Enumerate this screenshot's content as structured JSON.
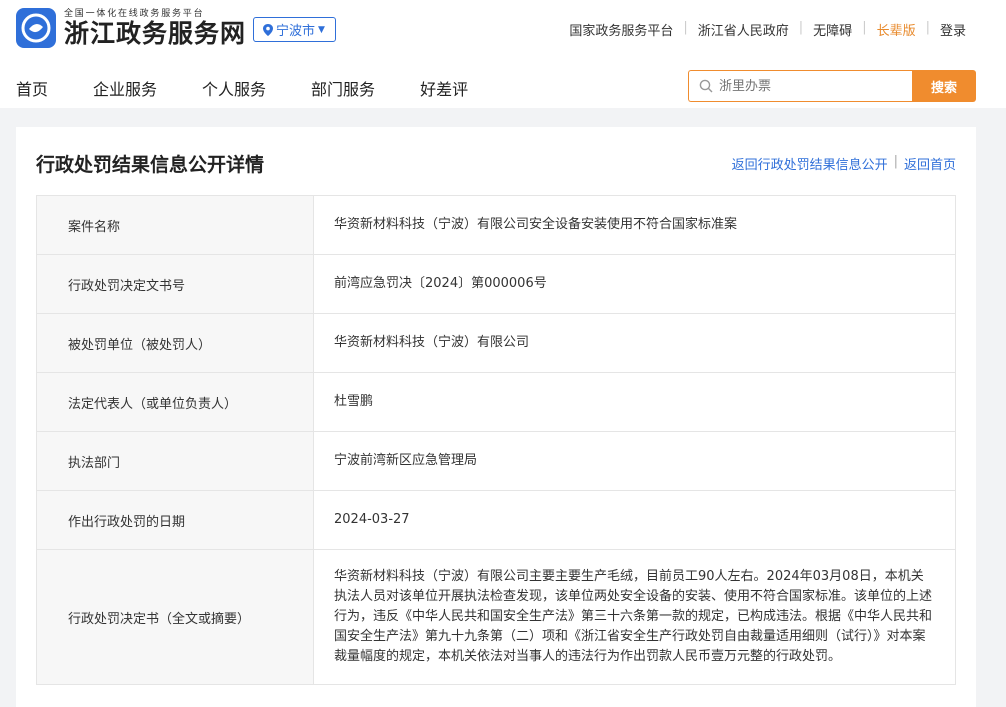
{
  "header": {
    "logo_sub": "全国一体化在线政务服务平台",
    "logo_title": "浙江政务服务网",
    "region": "宁波市",
    "links": [
      "国家政务服务平台",
      "浙江省人民政府",
      "无障碍",
      "长辈版",
      "登录"
    ],
    "accent_color": "#2f6fd9",
    "orange_color": "#f08c2e"
  },
  "nav": [
    "首页",
    "企业服务",
    "个人服务",
    "部门服务",
    "好差评"
  ],
  "search": {
    "placeholder": "浙里办票",
    "button": "搜索"
  },
  "page": {
    "title": "行政处罚结果信息公开详情",
    "back_list": "返回行政处罚结果信息公开",
    "back_home": "返回首页"
  },
  "details": [
    {
      "label": "案件名称",
      "value": "华资新材料科技（宁波）有限公司安全设备安装使用不符合国家标准案"
    },
    {
      "label": "行政处罚决定文书号",
      "value": "前湾应急罚决〔2024〕第000006号"
    },
    {
      "label": "被处罚单位（被处罚人）",
      "value": "华资新材料科技（宁波）有限公司"
    },
    {
      "label": "法定代表人（或单位负责人）",
      "value": "杜雪鹏"
    },
    {
      "label": "执法部门",
      "value": "宁波前湾新区应急管理局"
    },
    {
      "label": "作出行政处罚的日期",
      "value": "2024-03-27"
    },
    {
      "label": "行政处罚决定书（全文或摘要）",
      "value": "华资新材料科技（宁波）有限公司主要主要生产毛绒，目前员工90人左右。2024年03月08日，本机关执法人员对该单位开展执法检查发现，该单位两处安全设备的安装、使用不符合国家标准。该单位的上述行为，违反《中华人民共和国安全生产法》第三十六条第一款的规定，已构成违法。根据《中华人民共和国安全生产法》第九十九条第（二）项和《浙江省安全生产行政处罚自由裁量适用细则（试行）》对本案裁量幅度的规定，本机关依法对当事人的违法行为作出罚款人民币壹万元整的行政处罚。"
    }
  ]
}
